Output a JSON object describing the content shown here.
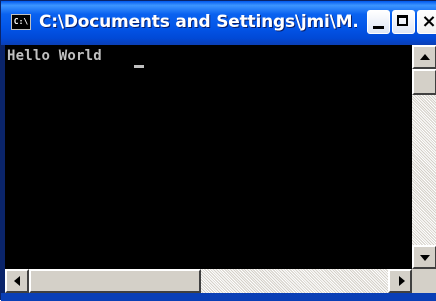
{
  "window": {
    "title": "C:\\Documents and Settings\\jmi\\M...",
    "icon": "console-app-icon",
    "icon_label": "C:\\",
    "controls": [
      "minimize-icon",
      "maximize-icon",
      "close-icon"
    ],
    "close_glyph": "×"
  },
  "console": {
    "output": "Hello World",
    "background": "#000000",
    "foreground": "#c0c0c0"
  },
  "colors": {
    "titlebar": "#0255e8",
    "scrollbar_face": "#d4d0c8"
  }
}
